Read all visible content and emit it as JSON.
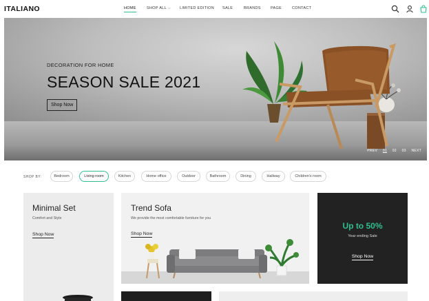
{
  "brand": {
    "logo": "ITALIANO"
  },
  "nav": {
    "items": [
      {
        "label": "HOME"
      },
      {
        "label": "SHOP ALL"
      },
      {
        "label": "LIMITED EDITION"
      },
      {
        "label": "SALE"
      },
      {
        "label": "BRANDS"
      },
      {
        "label": "PAGE"
      },
      {
        "label": "CONTACT"
      }
    ],
    "active_index": 0
  },
  "header_icons": [
    "search-icon",
    "user-icon",
    "cart-icon"
  ],
  "hero": {
    "subtitle": "DECORATION FOR HOME",
    "title": "SEASON SALE 2021",
    "button": "Shop Now",
    "pager": {
      "prev": "PREV",
      "pages": [
        "01",
        "02",
        "03"
      ],
      "current": 0,
      "next": "NEXT"
    }
  },
  "shop_by": {
    "label": "SHOP BY:",
    "chips": [
      "Bedroom",
      "Living room",
      "Kitchen",
      "Home office",
      "Outdoor",
      "Bathroom",
      "Dining",
      "Hallway",
      "Children's room"
    ],
    "active_index": 1
  },
  "cards": {
    "minimal": {
      "title": "Minimal Set",
      "subtitle": "Comfort and Style",
      "link": "Shop Now"
    },
    "trend": {
      "title": "Trend Sofa",
      "subtitle": "We provide the most comfortable furniture for you",
      "link": "Shop Now"
    },
    "promo": {
      "title": "Up to 50%",
      "subtitle": "Year ending Sale",
      "link": "Shop Now"
    }
  },
  "colors": {
    "accent": "#2fbf8f",
    "dark_card": "#222222",
    "hero_text": "#111111"
  }
}
